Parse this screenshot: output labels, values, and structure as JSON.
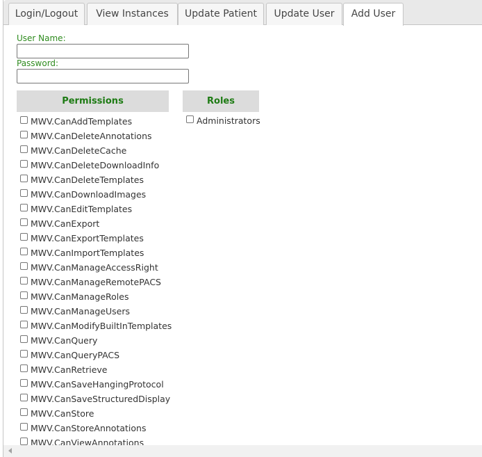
{
  "tabs": [
    {
      "label": "Login/Logout"
    },
    {
      "label": "View Instances"
    },
    {
      "label": "Update Patient"
    },
    {
      "label": "Update User"
    },
    {
      "label": "Add User"
    }
  ],
  "form": {
    "username_label": "User Name:",
    "username_value": "",
    "password_label": "Password:",
    "password_value": ""
  },
  "permissions": {
    "header": "Permissions",
    "items": [
      "MWV.CanAddTemplates",
      "MWV.CanDeleteAnnotations",
      "MWV.CanDeleteCache",
      "MWV.CanDeleteDownloadInfo",
      "MWV.CanDeleteTemplates",
      "MWV.CanDownloadImages",
      "MWV.CanEditTemplates",
      "MWV.CanExport",
      "MWV.CanExportTemplates",
      "MWV.CanImportTemplates",
      "MWV.CanManageAccessRight",
      "MWV.CanManageRemotePACS",
      "MWV.CanManageRoles",
      "MWV.CanManageUsers",
      "MWV.CanModifyBuiltInTemplates",
      "MWV.CanQuery",
      "MWV.CanQueryPACS",
      "MWV.CanRetrieve",
      "MWV.CanSaveHangingProtocol",
      "MWV.CanSaveStructuredDisplay",
      "MWV.CanStore",
      "MWV.CanStoreAnnotations",
      "MWV.CanViewAnnotations"
    ]
  },
  "roles": {
    "header": "Roles",
    "items": [
      "Administrators"
    ]
  },
  "colors": {
    "label_green": "#2e8b1e",
    "header_green": "#1e7b14",
    "header_bg": "#dcdcdc"
  }
}
